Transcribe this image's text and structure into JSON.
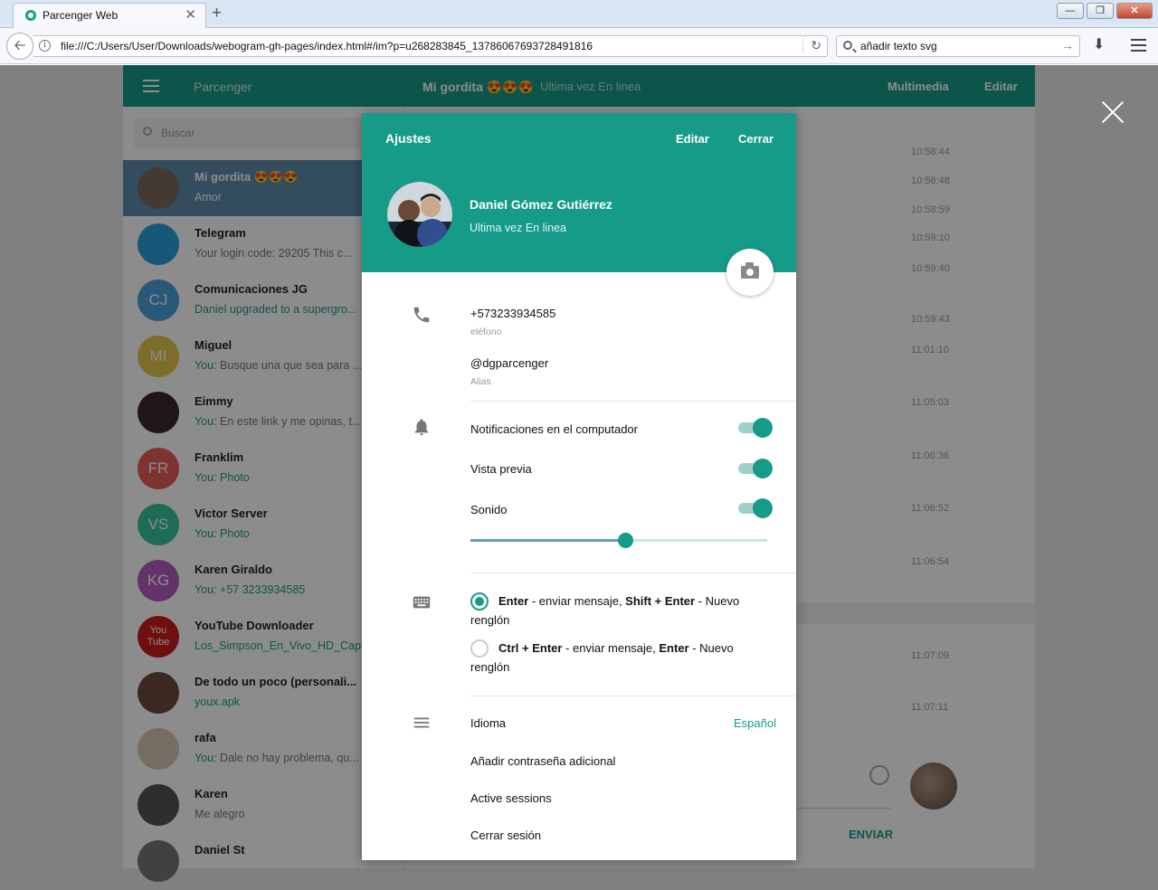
{
  "browser": {
    "tab_title": "Parcenger Web",
    "tab_close": "✕",
    "new_tab": "+",
    "url": "file:///C:/Users/User/Downloads/webogram-gh-pages/index.html#/im?p=u268283845_13786067693728491816",
    "search_text": "añadir texto svg",
    "window_buttons": [
      "—",
      "❐",
      "✕"
    ]
  },
  "app": {
    "name": "Parcenger",
    "chat_title": "Mi gordita 😍😍😍",
    "chat_status": "Ultima vez En linea",
    "header_media": "Multimedia",
    "header_edit": "Editar",
    "search_placeholder": "Buscar",
    "send_label": "ENVIAR"
  },
  "dialogs": [
    {
      "name": "Mi gordita 😍😍😍",
      "you": "",
      "msg": "Amor",
      "initials": "",
      "color": "#7e6a5d"
    },
    {
      "name": "Telegram",
      "you": "",
      "msg": "Your login code: 29205 This c...",
      "initials": "",
      "color": "#2aa0da"
    },
    {
      "name": "Comunicaciones JG",
      "you": "",
      "msg": "Daniel upgraded to a supergro...",
      "initials": "CJ",
      "color": "#4da0db"
    },
    {
      "name": "Miguel",
      "you": "You: ",
      "msg": "Busque una que sea para ...",
      "initials": "MI",
      "color": "#e2c64c"
    },
    {
      "name": "Eimmy",
      "you": "You: ",
      "msg": "En este link y me opinas, t...",
      "initials": "",
      "color": "#3a2b2b"
    },
    {
      "name": "Franklim",
      "you": "You: ",
      "msg": "Photo",
      "initials": "FR",
      "color": "#e46058"
    },
    {
      "name": "Victor Server",
      "you": "You: ",
      "msg": "Photo",
      "initials": "VS",
      "color": "#37c39e"
    },
    {
      "name": "Karen Giraldo",
      "you": "You: ",
      "msg": "+57 3233934585",
      "initials": "KG",
      "color": "#b55cc0"
    },
    {
      "name": "YouTube Downloader",
      "you": "",
      "msg": "Los_Simpson_En_Vivo_HD_Capi...",
      "initials": "You Tube",
      "color": "#c81e1e"
    },
    {
      "name": "De todo un poco (personali...",
      "you": "",
      "msg": "youx.apk",
      "initials": "",
      "color": "#6b4a3c"
    },
    {
      "name": "rafa",
      "you": "You: ",
      "msg": "Dale no hay problema, qu...",
      "initials": "",
      "color": "#d9c8b5"
    },
    {
      "name": "Karen",
      "you": "",
      "msg": "Me alegro",
      "initials": "",
      "color": "#555555"
    },
    {
      "name": "Daniel St",
      "you": "",
      "msg": "",
      "initials": "",
      "color": "#777777"
    }
  ],
  "message_times": [
    "10:58:44",
    "10:58:48",
    "10:58:59",
    "10:59:10",
    "10:59:40",
    "10:59:43",
    "11:01:10",
    "11:05:03",
    "11:06:36",
    "11:06:52",
    "11:06:54",
    "11:07:09",
    "11:07:11"
  ],
  "settings": {
    "title": "Ajustes",
    "edit": "Editar",
    "close": "Cerrar",
    "profile_name": "Daniel Gómez Gutiérrez",
    "profile_status": "Ultima vez En linea",
    "phone": "+573233934585",
    "phone_label": "eléfono",
    "username": "@dgparcenger",
    "username_label": "Alias",
    "toggles": [
      {
        "label": "Notificaciones en el computador",
        "on": true
      },
      {
        "label": "Vista previa",
        "on": true
      },
      {
        "label": "Sonido",
        "on": true
      }
    ],
    "volume": 0.52,
    "send_options": [
      {
        "key": "Enter",
        "mid": " - enviar mensaje, ",
        "key2": "Shift + Enter",
        "tail": " - Nuevo renglón",
        "checked": true
      },
      {
        "key": "Ctrl + Enter",
        "mid": " - enviar mensaje, ",
        "key2": "Enter",
        "tail": " - Nuevo renglón",
        "checked": false
      }
    ],
    "language_label": "Idioma",
    "language_value": "Español",
    "extra_password": "Añadir contraseña adicional",
    "active_sessions": "Active sessions",
    "logout": "Cerrar sesión"
  },
  "colors": {
    "accent": "#169b89",
    "active_dialog": "#5e8cac"
  }
}
